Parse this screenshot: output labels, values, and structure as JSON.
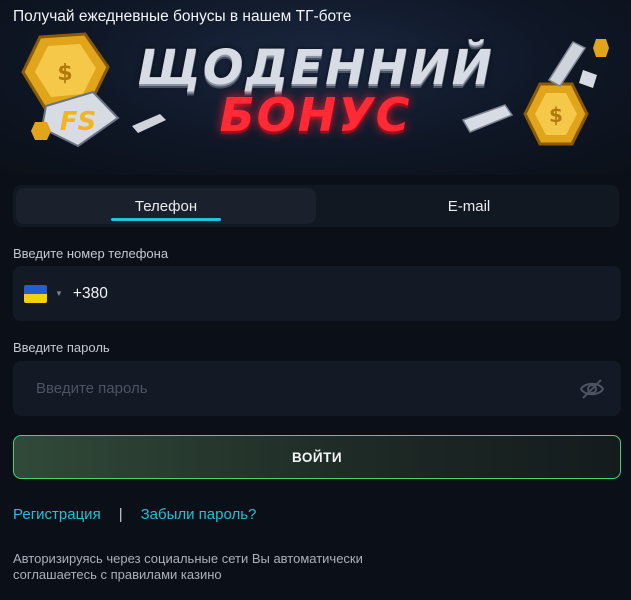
{
  "promo": {
    "text": "Получай ежедневные бонусы в нашем ТГ-боте",
    "banner_line1": "ЩОДЕННИЙ",
    "banner_line2": "БОНУС",
    "badge": "FS"
  },
  "tabs": [
    {
      "label": "Телефон",
      "active": true
    },
    {
      "label": "E-mail",
      "active": false
    }
  ],
  "phone": {
    "label": "Введите номер телефона",
    "country_flag": "ukraine-flag-icon",
    "prefix": "+380"
  },
  "password": {
    "label": "Введите пароль",
    "placeholder": "Введите пароль",
    "toggle_icon": "eye-slash-icon"
  },
  "login_button": "ВОЙТИ",
  "links": {
    "register": "Регистрация",
    "separator": "|",
    "forgot": "Забыли пароль?"
  },
  "disclaimer": "Авторизируясь через социальные сети Вы автоматически соглашаетесь с правилами казино",
  "colors": {
    "accent": "#1fc6d8",
    "button_border": "#43d47a",
    "banner_red": "#ff2a35"
  }
}
